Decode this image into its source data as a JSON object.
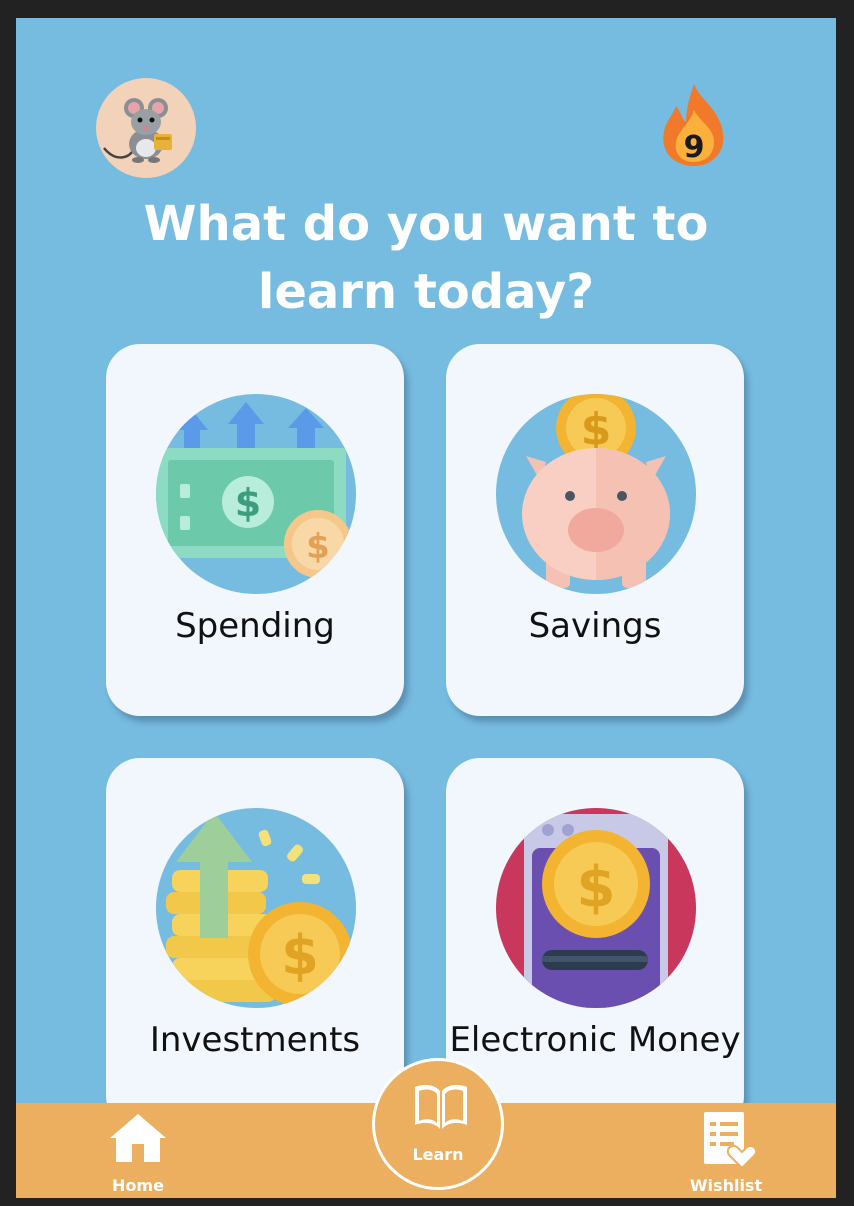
{
  "header": {
    "avatar_icon": "mouse-avatar-icon",
    "streak_icon": "flame-icon",
    "streak_count": "9"
  },
  "title_lines": [
    "What do you want to",
    "learn today?"
  ],
  "topics": [
    {
      "label": "Spending",
      "icon": "cash-money-icon"
    },
    {
      "label": "Savings",
      "icon": "piggy-bank-icon"
    },
    {
      "label": "Investments",
      "icon": "coin-stack-growth-icon"
    },
    {
      "label": "Electronic Money",
      "icon": "digital-coin-icon"
    }
  ],
  "nav": {
    "home": {
      "label": "Home",
      "icon": "home-icon"
    },
    "learn": {
      "label": "Learn",
      "icon": "book-icon"
    },
    "wishlist": {
      "label": "Wishlist",
      "icon": "wishlist-icon"
    }
  },
  "colors": {
    "background": "#76bbe0",
    "card": "#f2f7fd",
    "tabbar": "#ecaf60"
  }
}
